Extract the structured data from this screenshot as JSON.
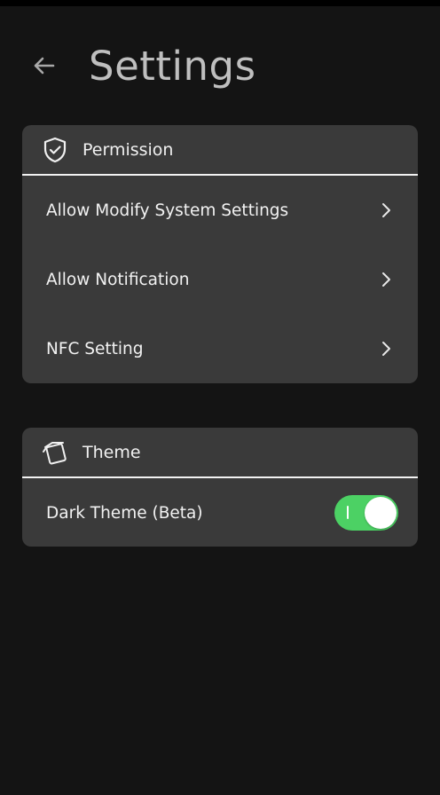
{
  "header": {
    "title": "Settings",
    "back_icon": "arrow-left-icon"
  },
  "permission": {
    "title": "Permission",
    "icon": "shield-check-icon",
    "items": [
      {
        "label": "Allow Modify System Settings",
        "icon": "chevron-right-icon"
      },
      {
        "label": "Allow Notification",
        "icon": "chevron-right-icon"
      },
      {
        "label": "NFC Setting",
        "icon": "chevron-right-icon"
      }
    ]
  },
  "theme": {
    "title": "Theme",
    "icon": "cards-icon",
    "dark_theme": {
      "label": "Dark Theme (Beta)",
      "enabled": true
    }
  },
  "colors": {
    "background": "#141414",
    "card": "#3a3a3a",
    "toggle_on": "#4cd164",
    "title_text": "#bfbfbf"
  }
}
